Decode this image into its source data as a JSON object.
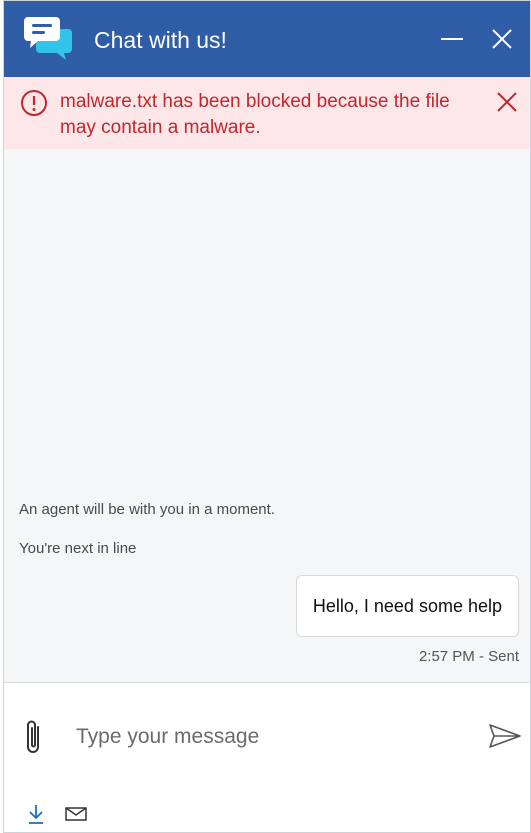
{
  "header": {
    "title": "Chat with us!",
    "logo_icon": "chat-bubbles-icon",
    "minimize_icon": "minimize-icon",
    "close_icon": "close-icon",
    "colors": {
      "background": "#2f5da6",
      "text": "#ffffff"
    }
  },
  "alert": {
    "message": "malware.txt has been blocked because the file may contain a malware.",
    "icon": "error-circle-icon",
    "close_icon": "close-icon",
    "colors": {
      "background": "#fde7e9",
      "text": "#c2272d"
    }
  },
  "messages": {
    "system": [
      "An agent will be with you in a moment.",
      "You're next in line"
    ],
    "user_message": "Hello, I need some help",
    "timestamp": "2:57 PM - Sent"
  },
  "composer": {
    "placeholder": "Type your message",
    "value": "",
    "attach_icon": "paperclip-icon",
    "send_icon": "send-icon",
    "download_icon": "download-icon",
    "email_icon": "email-icon"
  }
}
